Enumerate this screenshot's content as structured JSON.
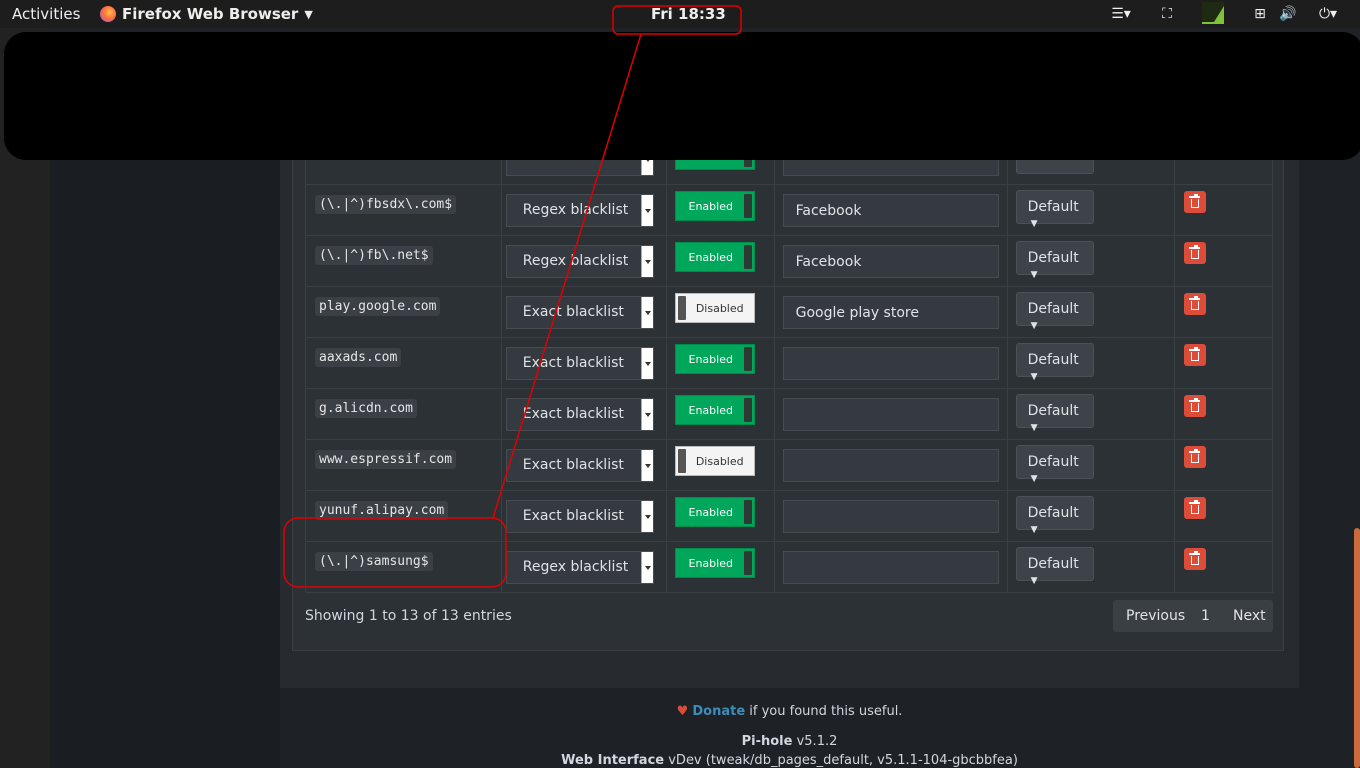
{
  "topbar": {
    "activities": "Activities",
    "app_name": "Firefox Web Browser",
    "clock": "Fri 18:33",
    "indicators": {
      "menu": "☰▾",
      "screen": "⛶",
      "network": "⊞",
      "volume": "🔊",
      "power": "⏻▾"
    }
  },
  "table": {
    "rows": [
      {
        "domain": "(\\.|^)fbsdx\\.com$",
        "type": "Regex blacklist",
        "status": "Enabled",
        "enabled": true,
        "comment": "Facebook",
        "group": "Default"
      },
      {
        "domain": "(\\.|^)fb\\.net$",
        "type": "Regex blacklist",
        "status": "Enabled",
        "enabled": true,
        "comment": "Facebook",
        "group": "Default"
      },
      {
        "domain": "play.google.com",
        "type": "Exact blacklist",
        "status": "Disabled",
        "enabled": false,
        "comment": "Google play store",
        "group": "Default"
      },
      {
        "domain": "aaxads.com",
        "type": "Exact blacklist",
        "status": "Enabled",
        "enabled": true,
        "comment": "",
        "group": "Default"
      },
      {
        "domain": "g.alicdn.com",
        "type": "Exact blacklist",
        "status": "Enabled",
        "enabled": true,
        "comment": "",
        "group": "Default"
      },
      {
        "domain": "www.espressif.com",
        "type": "Exact blacklist",
        "status": "Disabled",
        "enabled": false,
        "comment": "",
        "group": "Default"
      },
      {
        "domain": "yunuf.alipay.com",
        "type": "Exact blacklist",
        "status": "Enabled",
        "enabled": true,
        "comment": "",
        "group": "Default"
      },
      {
        "domain": "(\\.|^)samsung$",
        "type": "Regex blacklist",
        "status": "Enabled",
        "enabled": true,
        "comment": "",
        "group": "Default"
      }
    ]
  },
  "table_info": "Showing 1 to 13 of 13 entries",
  "pagination": {
    "previous": "Previous",
    "page": "1",
    "next": "Next"
  },
  "footer": {
    "donate": "Donate",
    "donate_suffix": "if you found this useful.",
    "pihole_label": "Pi-hole",
    "pihole_version": "v5.1.2",
    "web_label": "Web Interface",
    "web_version": "vDev (tweak/db_pages_default, v5.1.1-104-gbcbbfea)"
  },
  "colors": {
    "enabled_green": "#00a65a",
    "delete_red": "#dd4b39",
    "annotation_red": "#e00000",
    "link_blue": "#3c8dbc"
  }
}
